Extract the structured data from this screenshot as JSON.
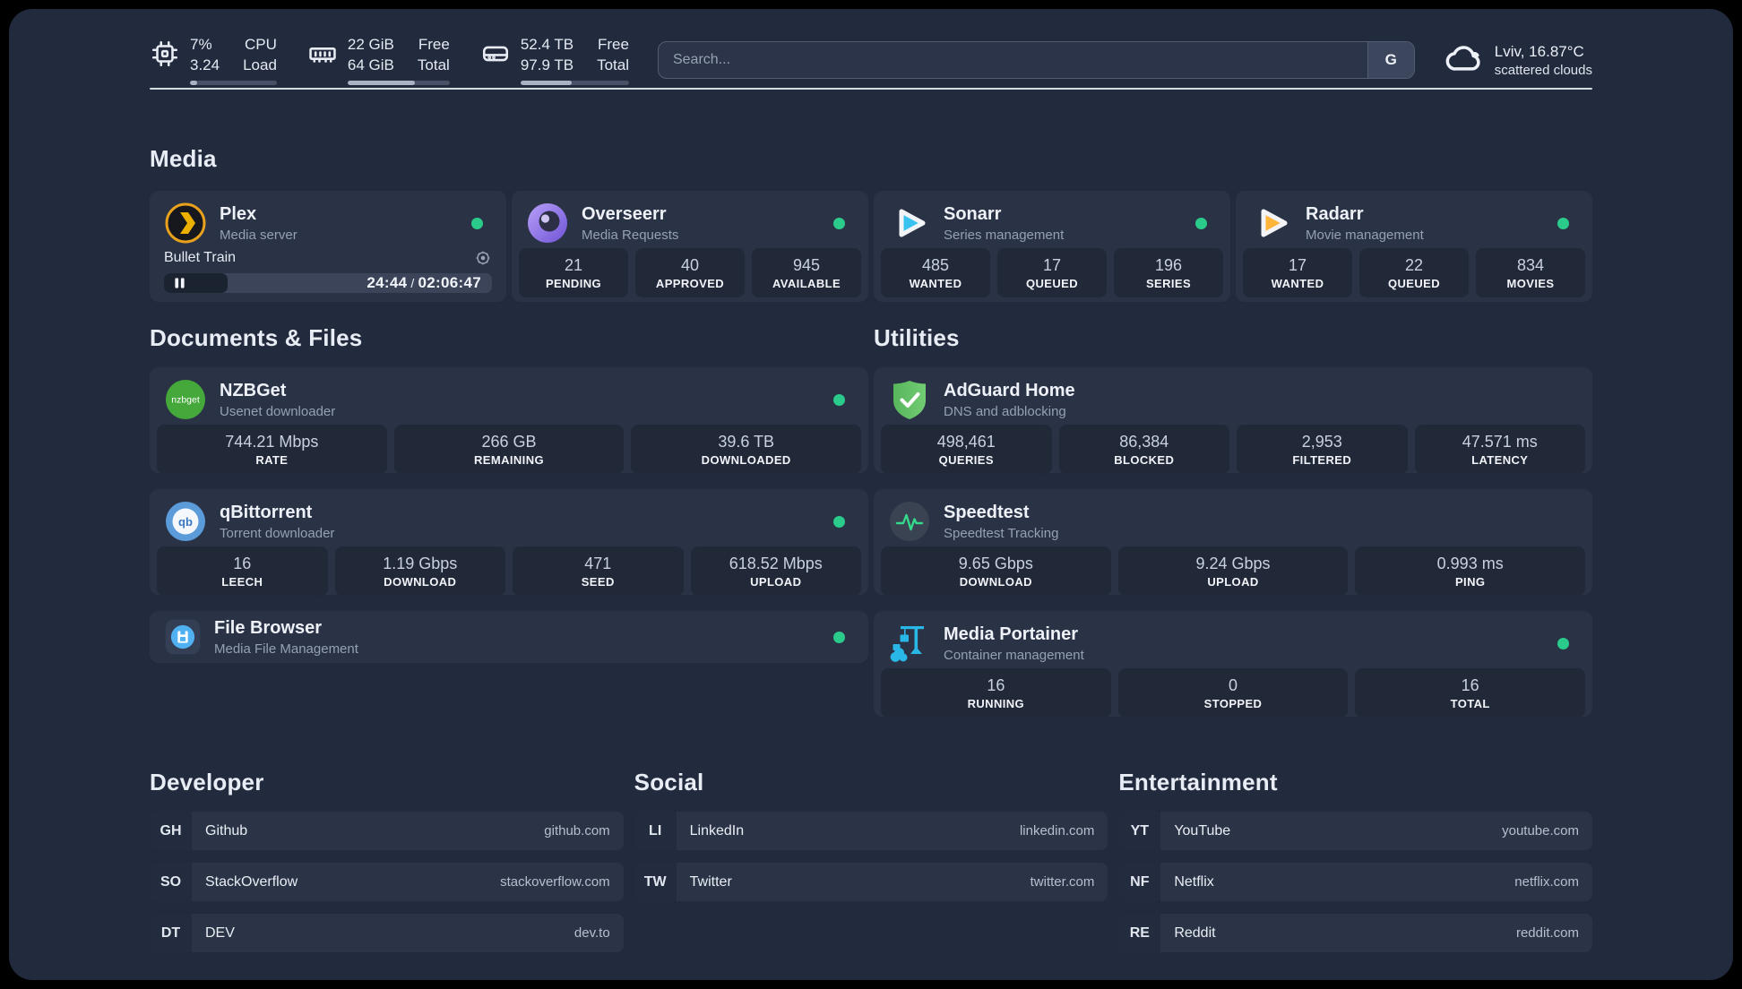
{
  "header": {
    "system_stats": [
      {
        "id": "cpu",
        "icon": "cpu-icon",
        "values": [
          "7%",
          "3.24"
        ],
        "labels": [
          "CPU",
          "Load"
        ],
        "progress_percent": 8
      },
      {
        "id": "memory",
        "icon": "ram-icon",
        "values": [
          "22 GiB",
          "64 GiB"
        ],
        "labels": [
          "Free",
          "Total"
        ],
        "progress_percent": 66
      },
      {
        "id": "storage",
        "icon": "disk-icon",
        "values": [
          "52.4 TB",
          "97.9 TB"
        ],
        "labels": [
          "Free",
          "Total"
        ],
        "progress_percent": 47
      }
    ],
    "search": {
      "placeholder": "Search...",
      "button_label": "G"
    },
    "weather": {
      "icon": "cloud-icon",
      "location_temp": "Lviv, 16.87°C",
      "condition": "scattered clouds"
    }
  },
  "sections": {
    "media": {
      "title": "Media",
      "apps": [
        {
          "name": "Plex",
          "description": "Media server",
          "icon": "plex-icon",
          "status": "online",
          "now_playing": {
            "title": "Bullet Train",
            "elapsed": "24:44",
            "time_separator": "/",
            "duration": "02:06:47",
            "progress_percent": 19.5
          }
        },
        {
          "name": "Overseerr",
          "description": "Media Requests",
          "icon": "overseerr-icon",
          "status": "online",
          "stats": [
            {
              "value": "21",
              "label": "PENDING"
            },
            {
              "value": "40",
              "label": "APPROVED"
            },
            {
              "value": "945",
              "label": "AVAILABLE"
            }
          ]
        },
        {
          "name": "Sonarr",
          "description": "Series management",
          "icon": "sonarr-icon",
          "status": "online",
          "stats": [
            {
              "value": "485",
              "label": "WANTED"
            },
            {
              "value": "17",
              "label": "QUEUED"
            },
            {
              "value": "196",
              "label": "SERIES"
            }
          ]
        },
        {
          "name": "Radarr",
          "description": "Movie management",
          "icon": "radarr-icon",
          "status": "online",
          "stats": [
            {
              "value": "17",
              "label": "WANTED"
            },
            {
              "value": "22",
              "label": "QUEUED"
            },
            {
              "value": "834",
              "label": "MOVIES"
            }
          ]
        }
      ]
    },
    "documents": {
      "title": "Documents & Files",
      "apps": [
        {
          "name": "NZBGet",
          "description": "Usenet downloader",
          "icon": "nzbget-icon",
          "status": "online",
          "stats": [
            {
              "value": "744.21 Mbps",
              "label": "RATE"
            },
            {
              "value": "266 GB",
              "label": "REMAINING"
            },
            {
              "value": "39.6 TB",
              "label": "DOWNLOADED"
            }
          ]
        },
        {
          "name": "qBittorrent",
          "description": "Torrent downloader",
          "icon": "qbittorrent-icon",
          "status": "online",
          "stats": [
            {
              "value": "16",
              "label": "LEECH"
            },
            {
              "value": "1.19 Gbps",
              "label": "DOWNLOAD"
            },
            {
              "value": "471",
              "label": "SEED"
            },
            {
              "value": "618.52 Mbps",
              "label": "UPLOAD"
            }
          ]
        },
        {
          "name": "File Browser",
          "description": "Media File Management",
          "icon": "filebrowser-icon",
          "status": "online"
        }
      ]
    },
    "utilities": {
      "title": "Utilities",
      "apps": [
        {
          "name": "AdGuard Home",
          "description": "DNS and adblocking",
          "icon": "adguard-icon",
          "status": null,
          "stats": [
            {
              "value": "498,461",
              "label": "QUERIES"
            },
            {
              "value": "86,384",
              "label": "BLOCKED"
            },
            {
              "value": "2,953",
              "label": "FILTERED"
            },
            {
              "value": "47.571 ms",
              "label": "LATENCY"
            }
          ]
        },
        {
          "name": "Speedtest",
          "description": "Speedtest Tracking",
          "icon": "speedtest-icon",
          "status": null,
          "stats": [
            {
              "value": "9.65 Gbps",
              "label": "DOWNLOAD"
            },
            {
              "value": "9.24 Gbps",
              "label": "UPLOAD"
            },
            {
              "value": "0.993 ms",
              "label": "PING"
            }
          ]
        },
        {
          "name": "Media Portainer",
          "description": "Container management",
          "icon": "portainer-icon",
          "status": "online",
          "stats": [
            {
              "value": "16",
              "label": "RUNNING"
            },
            {
              "value": "0",
              "label": "STOPPED"
            },
            {
              "value": "16",
              "label": "TOTAL"
            }
          ]
        }
      ]
    },
    "bookmarks": [
      {
        "title": "Developer",
        "links": [
          {
            "abbr": "GH",
            "name": "Github",
            "url": "github.com"
          },
          {
            "abbr": "SO",
            "name": "StackOverflow",
            "url": "stackoverflow.com"
          },
          {
            "abbr": "DT",
            "name": "DEV",
            "url": "dev.to"
          }
        ]
      },
      {
        "title": "Social",
        "links": [
          {
            "abbr": "LI",
            "name": "LinkedIn",
            "url": "linkedin.com"
          },
          {
            "abbr": "TW",
            "name": "Twitter",
            "url": "twitter.com"
          }
        ]
      },
      {
        "title": "Entertainment",
        "links": [
          {
            "abbr": "YT",
            "name": "YouTube",
            "url": "youtube.com"
          },
          {
            "abbr": "NF",
            "name": "Netflix",
            "url": "netflix.com"
          },
          {
            "abbr": "RE",
            "name": "Reddit",
            "url": "reddit.com"
          }
        ]
      }
    ]
  },
  "colors": {
    "status_online": "#2bcb8c",
    "background": "#222a3d",
    "card": "#2a3346",
    "stat_box": "#212938"
  }
}
